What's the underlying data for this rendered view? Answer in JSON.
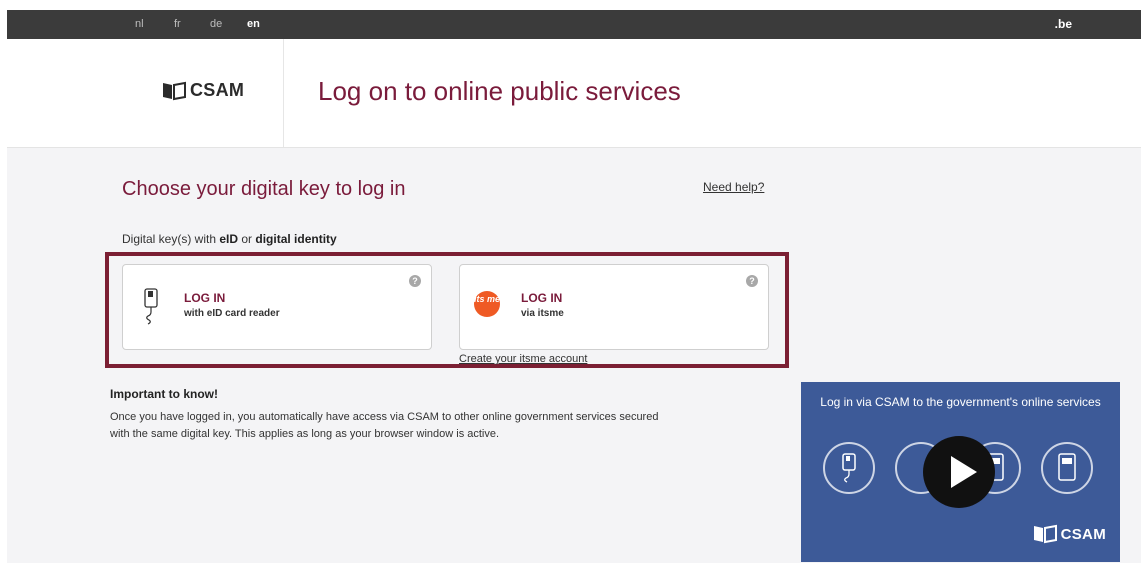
{
  "topbar": {
    "languages": [
      "nl",
      "fr",
      "de",
      "en"
    ],
    "active_language": "en",
    "gov_link": ".be"
  },
  "header": {
    "logo_text": "CSAM",
    "title": "Log on to online public services"
  },
  "main": {
    "choose_title": "Choose your digital key to log in",
    "help_link": "Need help?",
    "keys_subtitle": {
      "prefix": "Digital key(s) with ",
      "bold1": "eID",
      "middle": " or ",
      "bold2": "digital identity"
    },
    "cards": [
      {
        "title": "LOG IN",
        "subtitle": "with eID card reader",
        "icon": "card-reader-icon",
        "help": "?"
      },
      {
        "title": "LOG IN",
        "subtitle": "via itsme",
        "icon": "itsme-icon",
        "help": "?",
        "badge_text": "its me"
      }
    ],
    "create_account_link": "Create your itsme account",
    "important": {
      "title": "Important to know!",
      "text": "Once you have logged in, you automatically have access via CSAM to other online government services secured with the same digital key. This applies as long as your browser window is active."
    }
  },
  "video": {
    "title": "Log in via CSAM to the government's online services",
    "logo_text": "CSAM",
    "icons": [
      "card-reader-icon",
      "itsme-icon",
      "app-icon",
      "sms-icon"
    ]
  },
  "colors": {
    "brand": "#7a1b3b",
    "highlight_border": "#7b1f33",
    "itsme": "#ef5a24",
    "video_bg": "#3d5a98"
  }
}
